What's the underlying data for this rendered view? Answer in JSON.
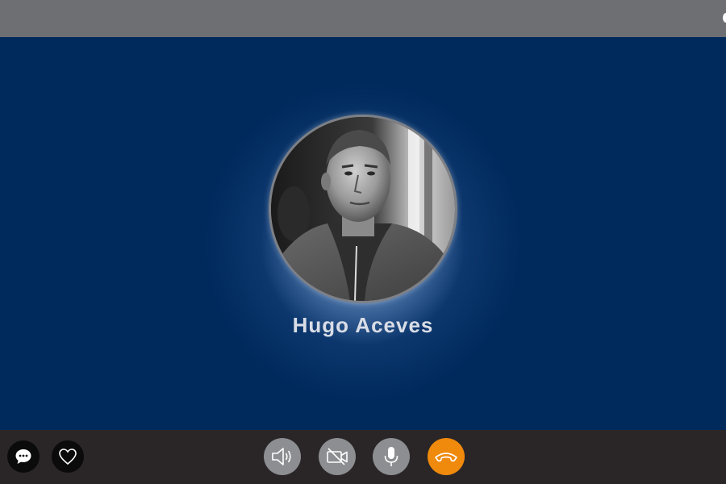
{
  "call": {
    "caller_name": "Hugo Aceves"
  },
  "icons": {
    "chat": "chat-bubble-icon",
    "favorite": "heart-icon",
    "speaker": "speaker-icon",
    "video": "video-off-icon",
    "microphone": "microphone-icon",
    "hangup": "phone-hangup-icon"
  },
  "colors": {
    "background": "#002a5c",
    "top_bar": "#6e6f73",
    "bottom_bar": "#2a2627",
    "control_button": "#8d8e92",
    "hangup_button": "#f08a0c"
  }
}
